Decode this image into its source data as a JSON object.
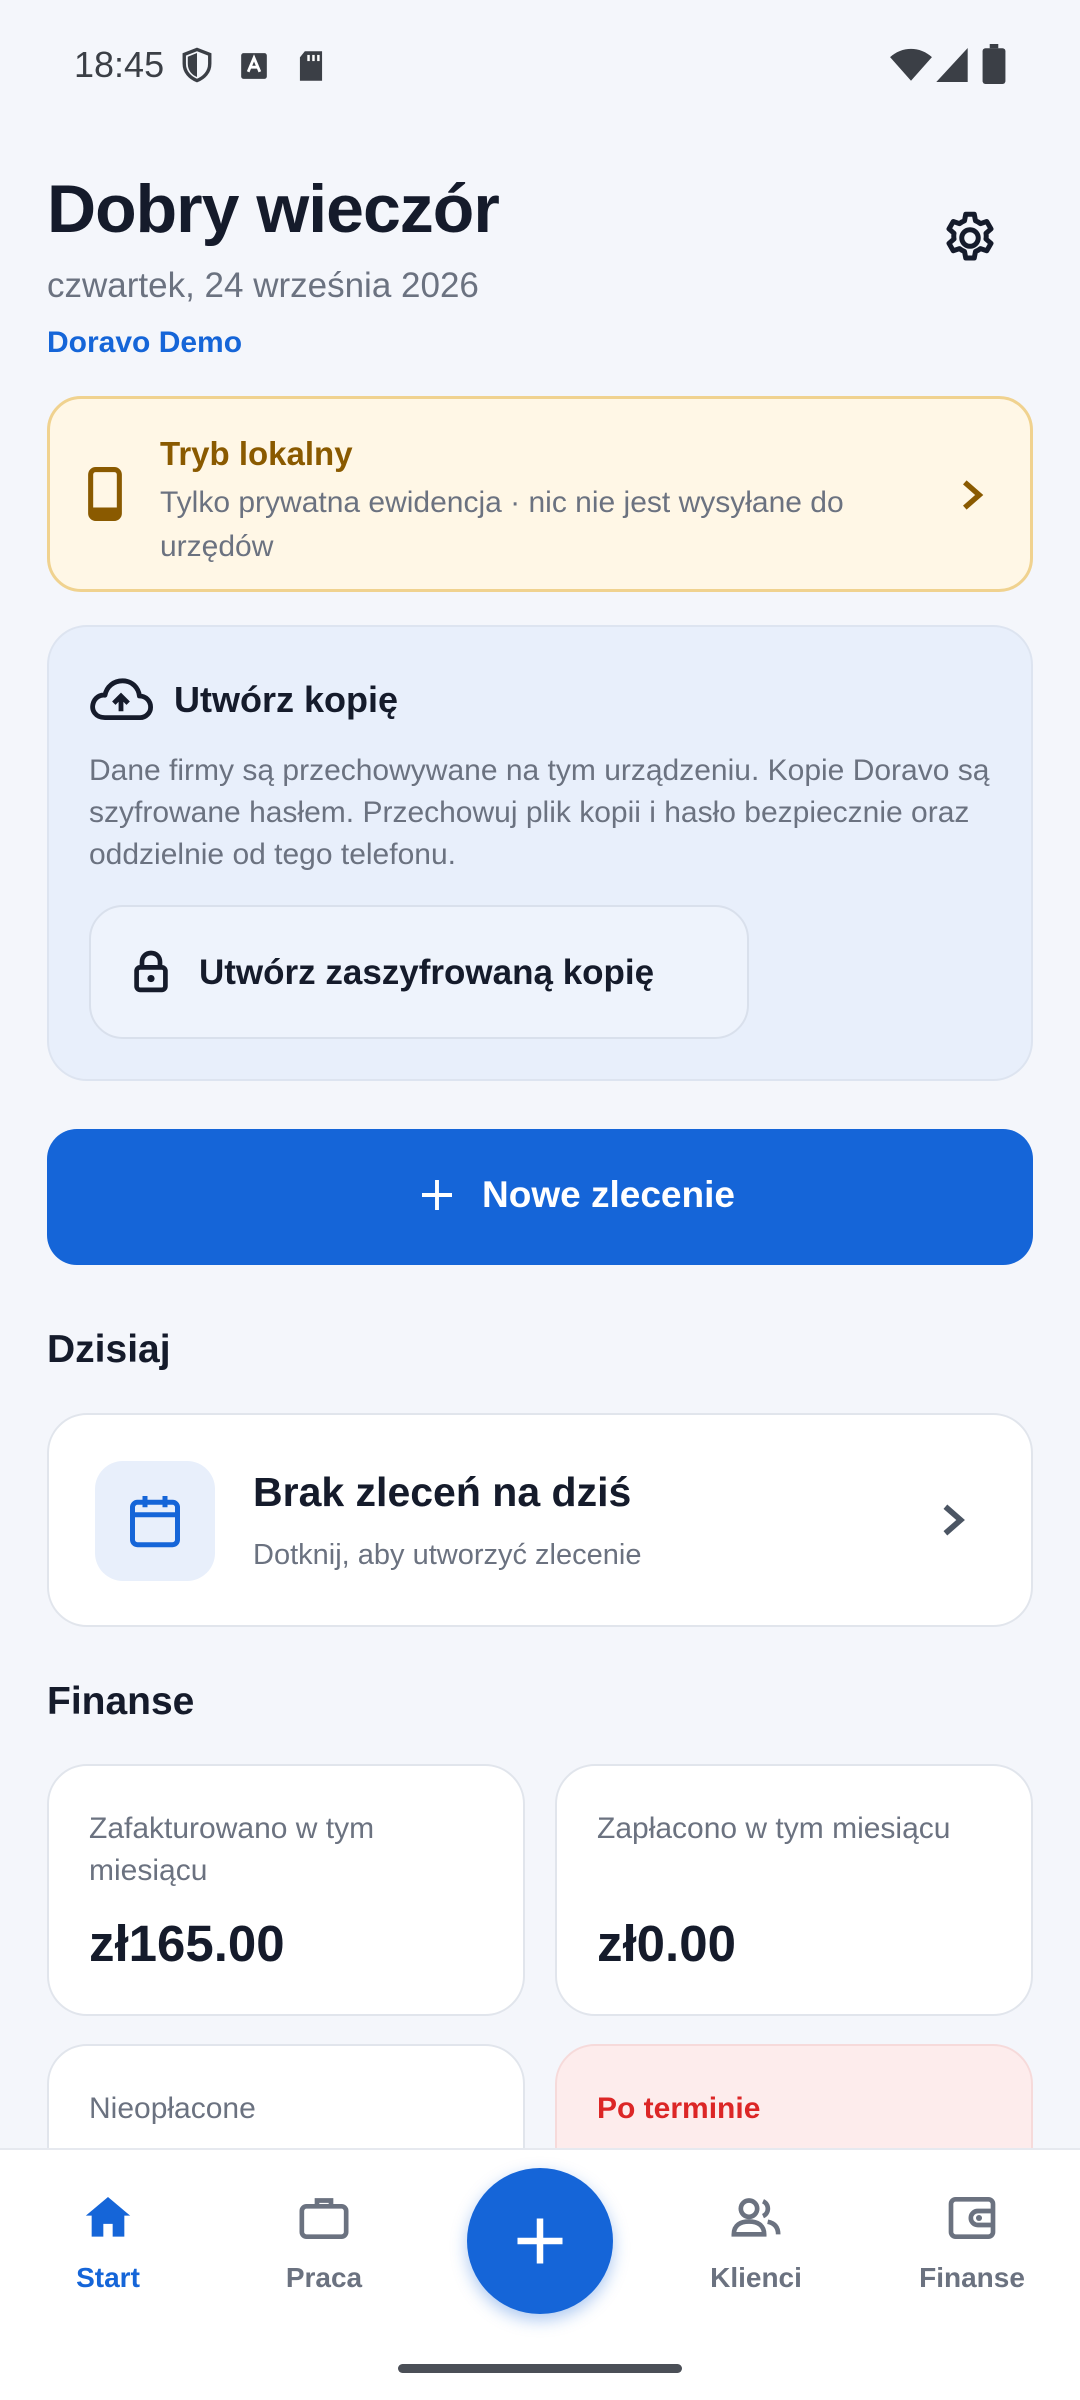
{
  "status_bar": {
    "time": "18:45"
  },
  "header": {
    "greeting": "Dobry wieczór",
    "date": "czwartek, 24 września 2026",
    "company": "Doravo Demo"
  },
  "local_mode": {
    "title": "Tryb lokalny",
    "subtitle": "Tylko prywatna ewidencja · nic nie jest wysyłane do urzędów"
  },
  "backup": {
    "title": "Utwórz kopię",
    "description": "Dane firmy są przechowywane na tym urządzeniu. Kopie Doravo są szyfrowane hasłem. Przechowuj plik kopii i hasło bezpiecznie oraz oddzielnie od tego telefonu.",
    "button_label": "Utwórz zaszyfrowaną kopię"
  },
  "new_order": {
    "label": "Nowe zlecenie"
  },
  "today": {
    "heading": "Dzisiaj",
    "card_title": "Brak zleceń na dziś",
    "card_subtitle": "Dotknij, aby utworzyć zlecenie"
  },
  "finance": {
    "heading": "Finanse",
    "cards": [
      {
        "label": "Zafakturowano w tym miesiącu",
        "value": "zł165.00"
      },
      {
        "label": "Zapłacono w tym miesiącu",
        "value": "zł0.00"
      },
      {
        "label": "Nieopłacone",
        "value": ""
      },
      {
        "label": "Po terminie",
        "value": ""
      }
    ]
  },
  "bottom_nav": {
    "items": [
      {
        "label": "Start",
        "icon": "home-icon",
        "active": true
      },
      {
        "label": "Praca",
        "icon": "briefcase-icon",
        "active": false
      },
      {
        "label": "Klienci",
        "icon": "people-icon",
        "active": false
      },
      {
        "label": "Finanse",
        "icon": "wallet-icon",
        "active": false
      }
    ]
  },
  "colors": {
    "primary": "#1565D8",
    "background": "#F4F6FB",
    "warning_bg": "#FFF7E6",
    "warning_text": "#8A5A00",
    "danger": "#DC2626"
  }
}
